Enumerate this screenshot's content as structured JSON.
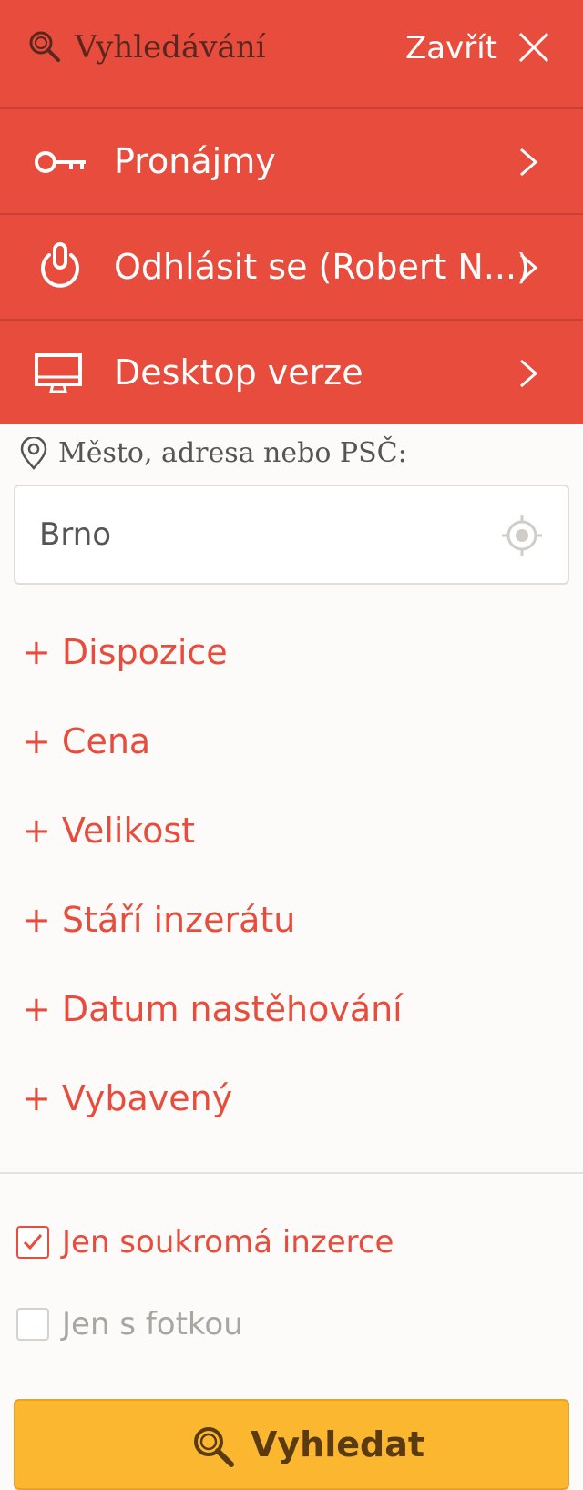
{
  "header": {
    "title": "Vyhledávání",
    "close_label": "Zavřít"
  },
  "menu": [
    {
      "label": "Pronájmy",
      "icon": "key-icon"
    },
    {
      "label": "Odhlásit se (Robert N...)",
      "icon": "power-icon"
    },
    {
      "label": "Desktop verze",
      "icon": "monitor-icon"
    }
  ],
  "location": {
    "label": "Město, adresa nebo PSČ:",
    "value": "Brno",
    "placeholder": ""
  },
  "filters": [
    "+ Dispozice",
    "+ Cena",
    "+ Velikost",
    "+ Stáří inzerátu",
    "+ Datum nastěhování",
    "+ Vybavený"
  ],
  "checkboxes": [
    {
      "label": "Jen soukromá inzerce",
      "checked": true
    },
    {
      "label": "Jen s fotkou",
      "checked": false
    }
  ],
  "search_button": {
    "label": "Vyhledat"
  },
  "colors": {
    "accent": "#e74c3c",
    "button": "#fbb730",
    "background": "#fdfbf9"
  }
}
